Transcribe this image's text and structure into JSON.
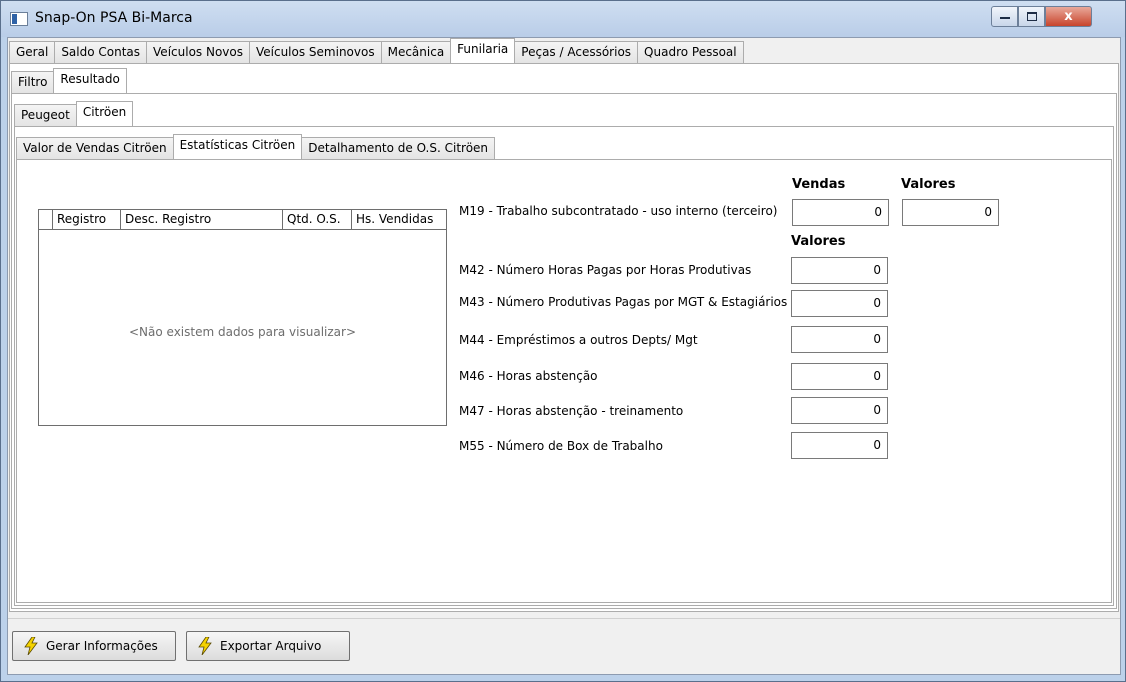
{
  "window": {
    "title": "Snap-On PSA Bi-Marca",
    "close_glyph": "x"
  },
  "main_tabs": [
    "Geral",
    "Saldo Contas",
    "Veículos Novos",
    "Veículos Seminovos",
    "Mecânica",
    "Funilaria",
    "Peças / Acessórios",
    "Quadro Pessoal"
  ],
  "sub_tabs": [
    "Filtro",
    "Resultado"
  ],
  "brand_tabs": [
    "Peugeot",
    "Citröen"
  ],
  "report_tabs": [
    "Valor de Vendas Citröen",
    "Estatísticas Citröen",
    "Detalhamento de O.S. Citröen"
  ],
  "grid": {
    "columns": [
      "Registro",
      "Desc. Registro",
      "Qtd. O.S.",
      "Hs. Vendidas"
    ],
    "empty_text": "<Não existem dados para visualizar>"
  },
  "form": {
    "header_vendas": "Vendas",
    "header_valores": "Valores",
    "header_valores2": "Valores",
    "m19_label": "M19 - Trabalho subcontratado - uso interno (terceiro)",
    "m19_vendas": "0",
    "m19_valores": "0",
    "rows": [
      {
        "label": "M42 - Número Horas Pagas por Horas Produtivas",
        "value": "0"
      },
      {
        "label": "M43 - Número Produtivas Pagas por MGT & Estagiários",
        "value": "0"
      },
      {
        "label": "M44 - Empréstimos a outros Depts/ Mgt",
        "value": "0"
      },
      {
        "label": "M46 - Horas abstenção",
        "value": "0"
      },
      {
        "label": "M47 - Horas abstenção - treinamento",
        "value": "0"
      },
      {
        "label": "M55 - Número de Box de Trabalho",
        "value": "0"
      }
    ]
  },
  "buttons": {
    "generate": "Gerar Informações",
    "export": "Exportar Arquivo"
  },
  "colors": {
    "titlebar": "#b9cde8",
    "close": "#c8442b",
    "bolt": "#f5d300"
  }
}
